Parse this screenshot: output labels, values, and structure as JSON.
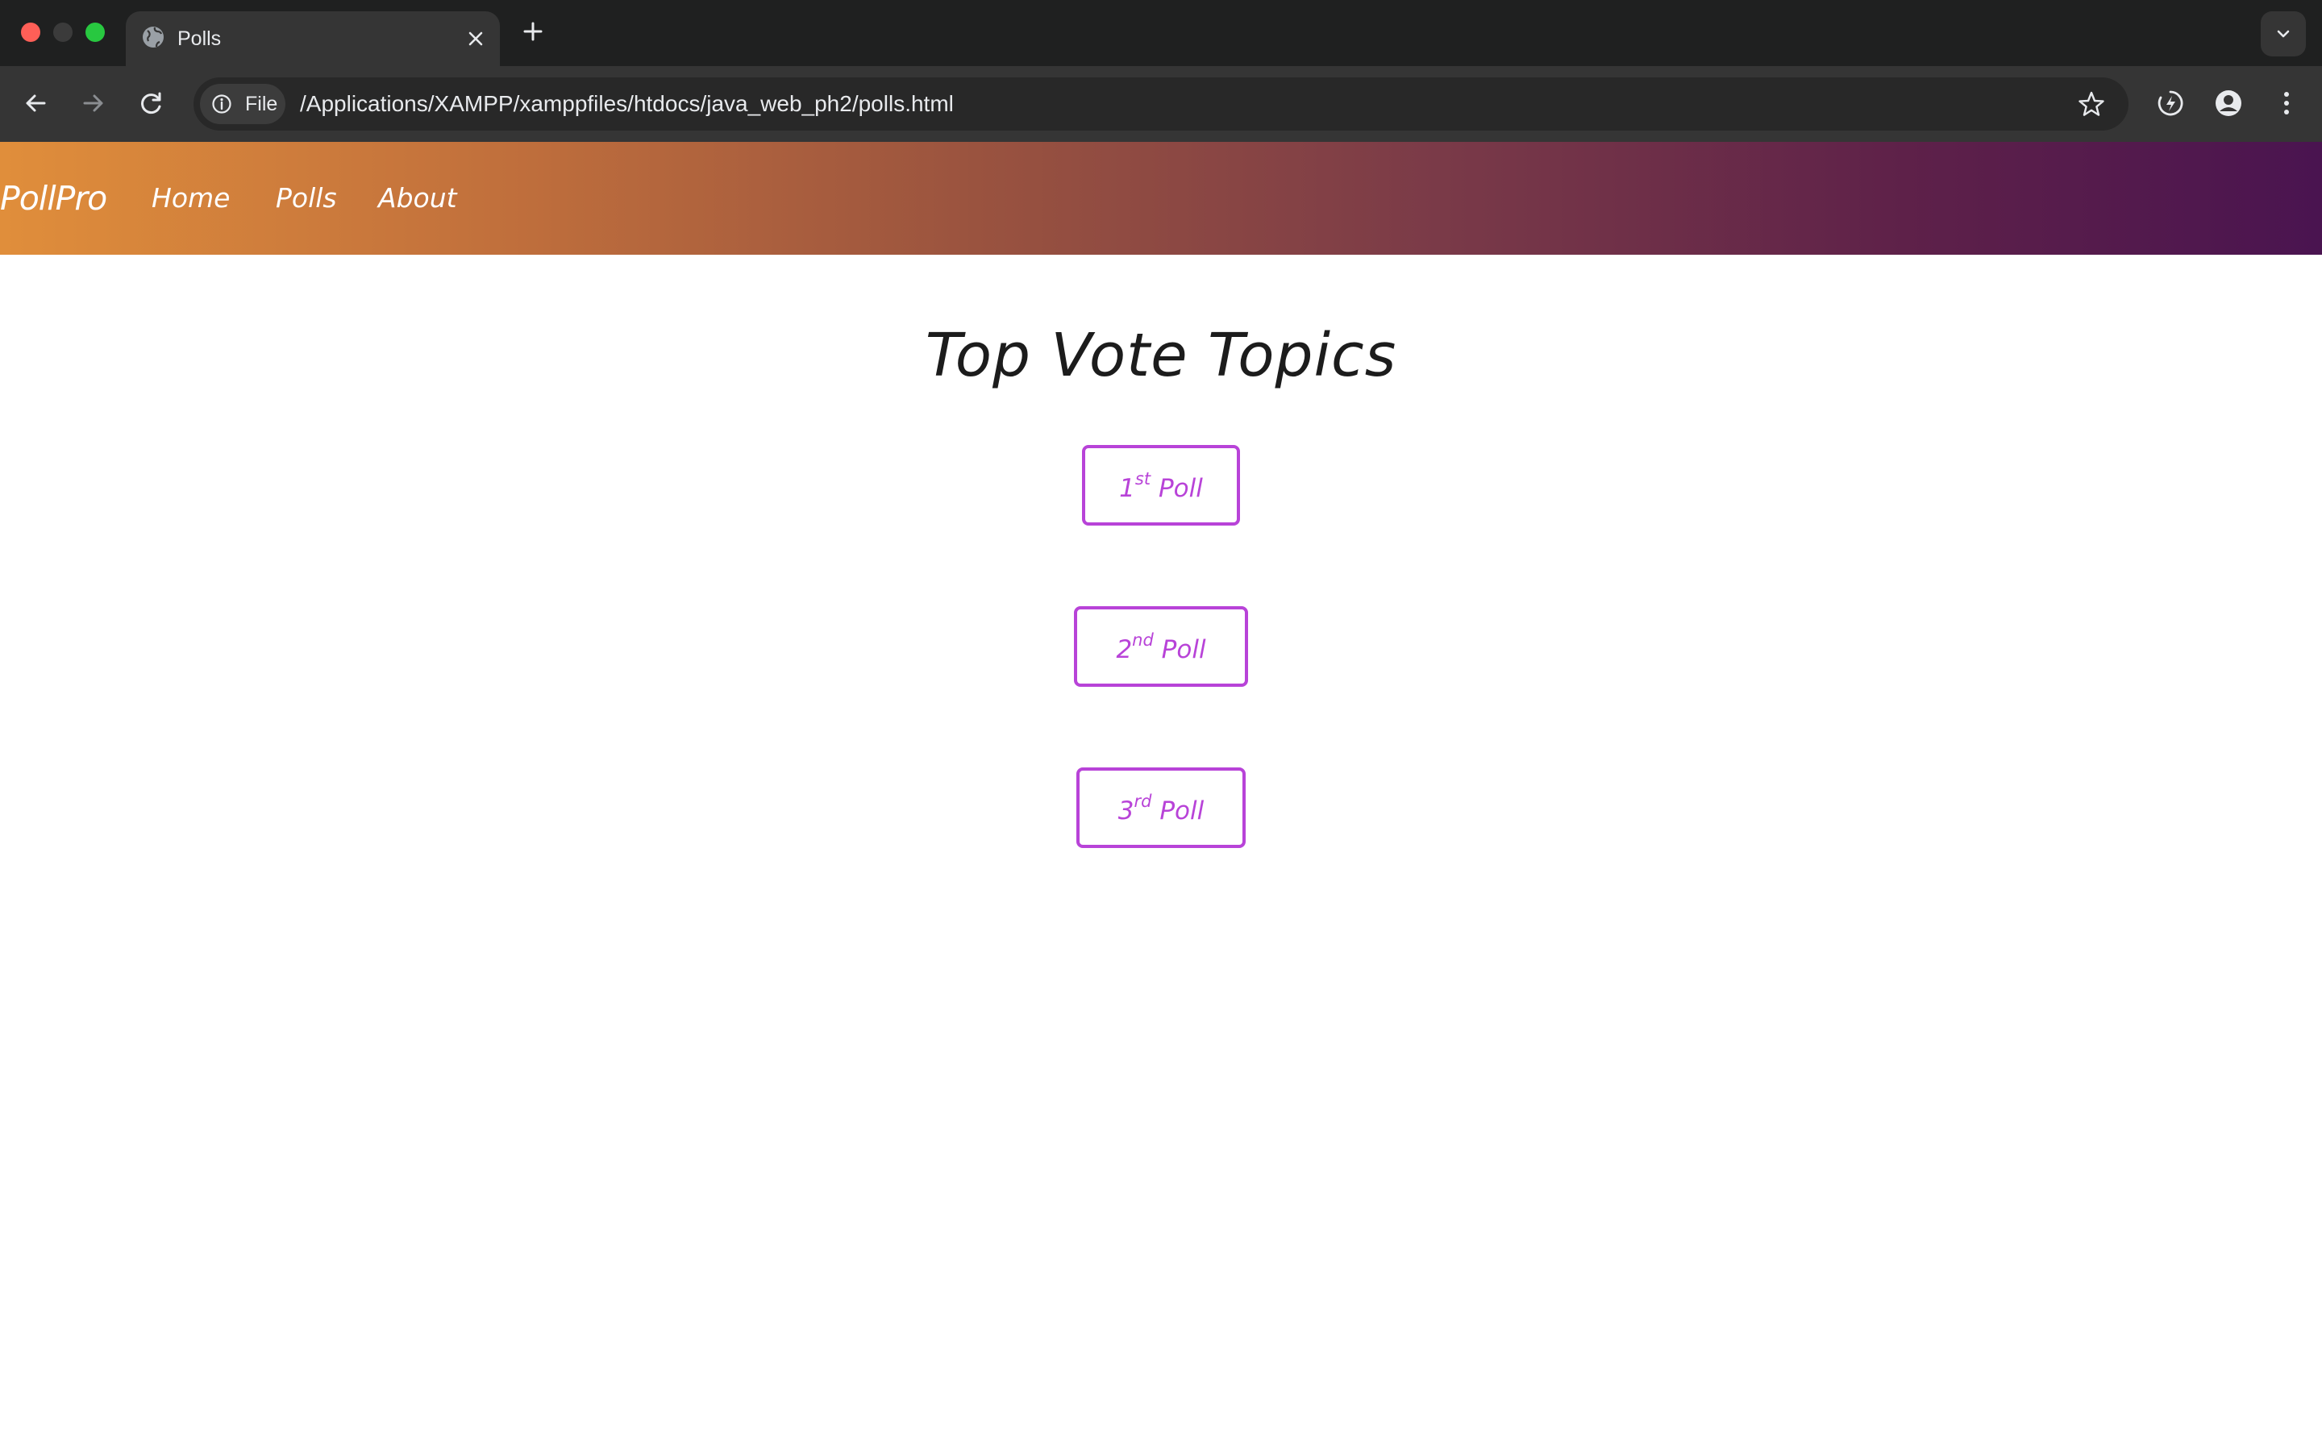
{
  "browser": {
    "tab_title": "Polls",
    "file_chip_label": "File",
    "url": "/Applications/XAMPP/xamppfiles/htdocs/java_web_ph2/polls.html"
  },
  "nav": {
    "brand": "PollPro",
    "links": [
      {
        "label": "Home"
      },
      {
        "label": "Polls"
      },
      {
        "label": "About"
      }
    ]
  },
  "main": {
    "heading": "Top Vote Topics",
    "polls": [
      {
        "number": "1",
        "suffix": "st",
        "word": "Poll"
      },
      {
        "number": "2",
        "suffix": "nd",
        "word": "Poll"
      },
      {
        "number": "3",
        "suffix": "rd",
        "word": "Poll"
      }
    ]
  },
  "colors": {
    "accent": "#b843d8",
    "nav_gradient_start": "#e08e3b",
    "nav_gradient_end": "#4a1450"
  },
  "icons": {
    "tab": "globe-icon",
    "back": "arrow-left-icon",
    "forward": "arrow-right-icon",
    "reload": "reload-icon",
    "info": "info-icon",
    "bookmark": "star-icon",
    "extension": "performance-icon",
    "profile": "profile-icon",
    "menu": "kebab-menu-icon"
  }
}
